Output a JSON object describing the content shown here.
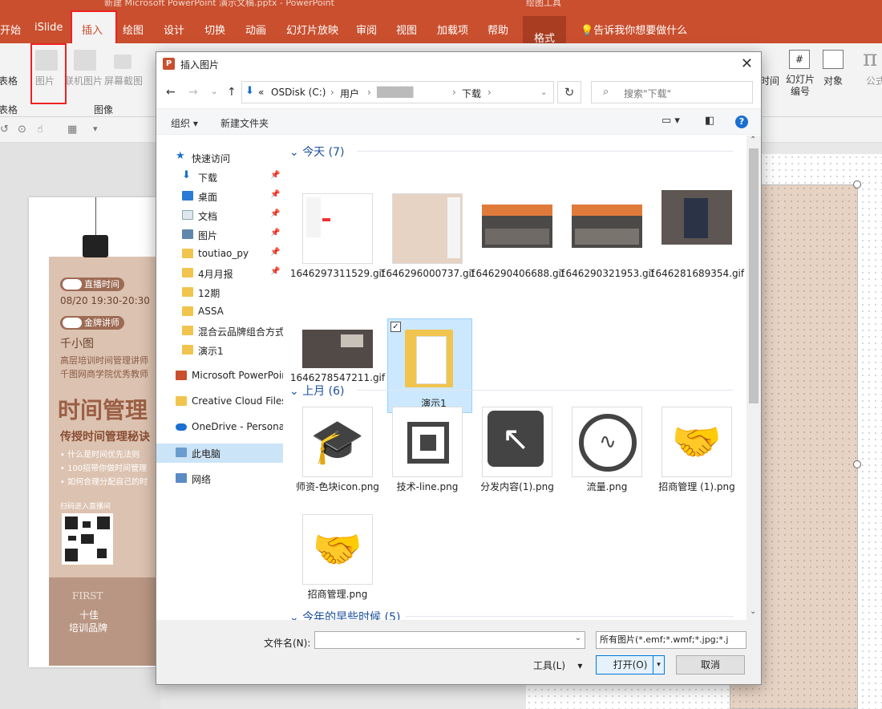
{
  "window": {
    "title": "新建 Microsoft PowerPoint 演示文稿.pptx  -  PowerPoint",
    "context_tab": "绘图工具"
  },
  "menu": {
    "items": [
      "开始",
      "iSlide",
      "插入",
      "绘图",
      "设计",
      "切换",
      "动画",
      "幻灯片放映",
      "审阅",
      "视图",
      "加载项",
      "帮助",
      "格式"
    ],
    "tellme": "告诉我你想要做什么"
  },
  "ribbon": {
    "table": "表格",
    "table_group": "表格",
    "picture": "图片",
    "online_picture": "联机图片",
    "screenshot": "屏幕截图",
    "images_group": "图像",
    "datetime": "时间",
    "slide_number": "幻灯片\n编号",
    "object": "对象",
    "formula": "公式"
  },
  "poster": {
    "live_time_label": "直播时间",
    "live_time": "08/20  19:30-20:30",
    "speaker_label": "金牌讲师",
    "speaker": "千小图",
    "line1": "高层培训时间管理讲师",
    "line2": "千图网商学院优秀教师",
    "headline": "时间管理",
    "sub": "传授时间管理秘诀",
    "bullets": [
      "• 什么是时间优先法则",
      "• 100招带你做时间管理",
      "• 如何合理分配自己的时"
    ],
    "qr_label": "扫码进入直播间",
    "brand_en": "FIRST",
    "brand_line1": "十佳",
    "brand_line2": "培训品牌"
  },
  "dialog": {
    "title": "插入图片",
    "close": "✕",
    "address": {
      "prefix": "«",
      "segments": [
        "OSDisk (C:)",
        "用户",
        "██████",
        "下载"
      ]
    },
    "search_placeholder": "搜索\"下载\"",
    "toolbar": {
      "organize": "组织 ▾",
      "new_folder": "新建文件夹"
    },
    "nav": {
      "quick_access": "快速访问",
      "items": [
        "下载",
        "桌面",
        "文档",
        "图片",
        "toutiao_py",
        "4月月报",
        "12期",
        "ASSA",
        "混合云品牌组合方式",
        "演示1"
      ],
      "others": [
        "Microsoft PowerPoint",
        "Creative Cloud Files",
        "OneDrive - Personal",
        "此电脑",
        "网络"
      ]
    },
    "groups": [
      {
        "header": "今天 (7)",
        "files": [
          "1646297311529.gif",
          "1646296000737.gif",
          "1646290406688.gif",
          "1646290321953.gif",
          "1646281689354.gif",
          "演示1",
          "1646278547211.gif"
        ]
      },
      {
        "header": "上月 (6)",
        "files": [
          "师资-色块icon.png",
          "技术-line.png",
          "分发内容(1).png",
          "流量.png",
          "招商管理 (1).png",
          "招商管理.png"
        ]
      },
      {
        "header": "今年的早些时候 (5)",
        "files": []
      }
    ],
    "filename_label": "文件名(N):",
    "filename_value": "",
    "filter": "所有图片(*.emf;*.wmf;*.jpg;*.j",
    "tools": "工具(L)",
    "open": "打开(O)",
    "cancel": "取消"
  },
  "colors": {
    "accent": "#c94f2e",
    "link_blue": "#1a4f9c"
  }
}
